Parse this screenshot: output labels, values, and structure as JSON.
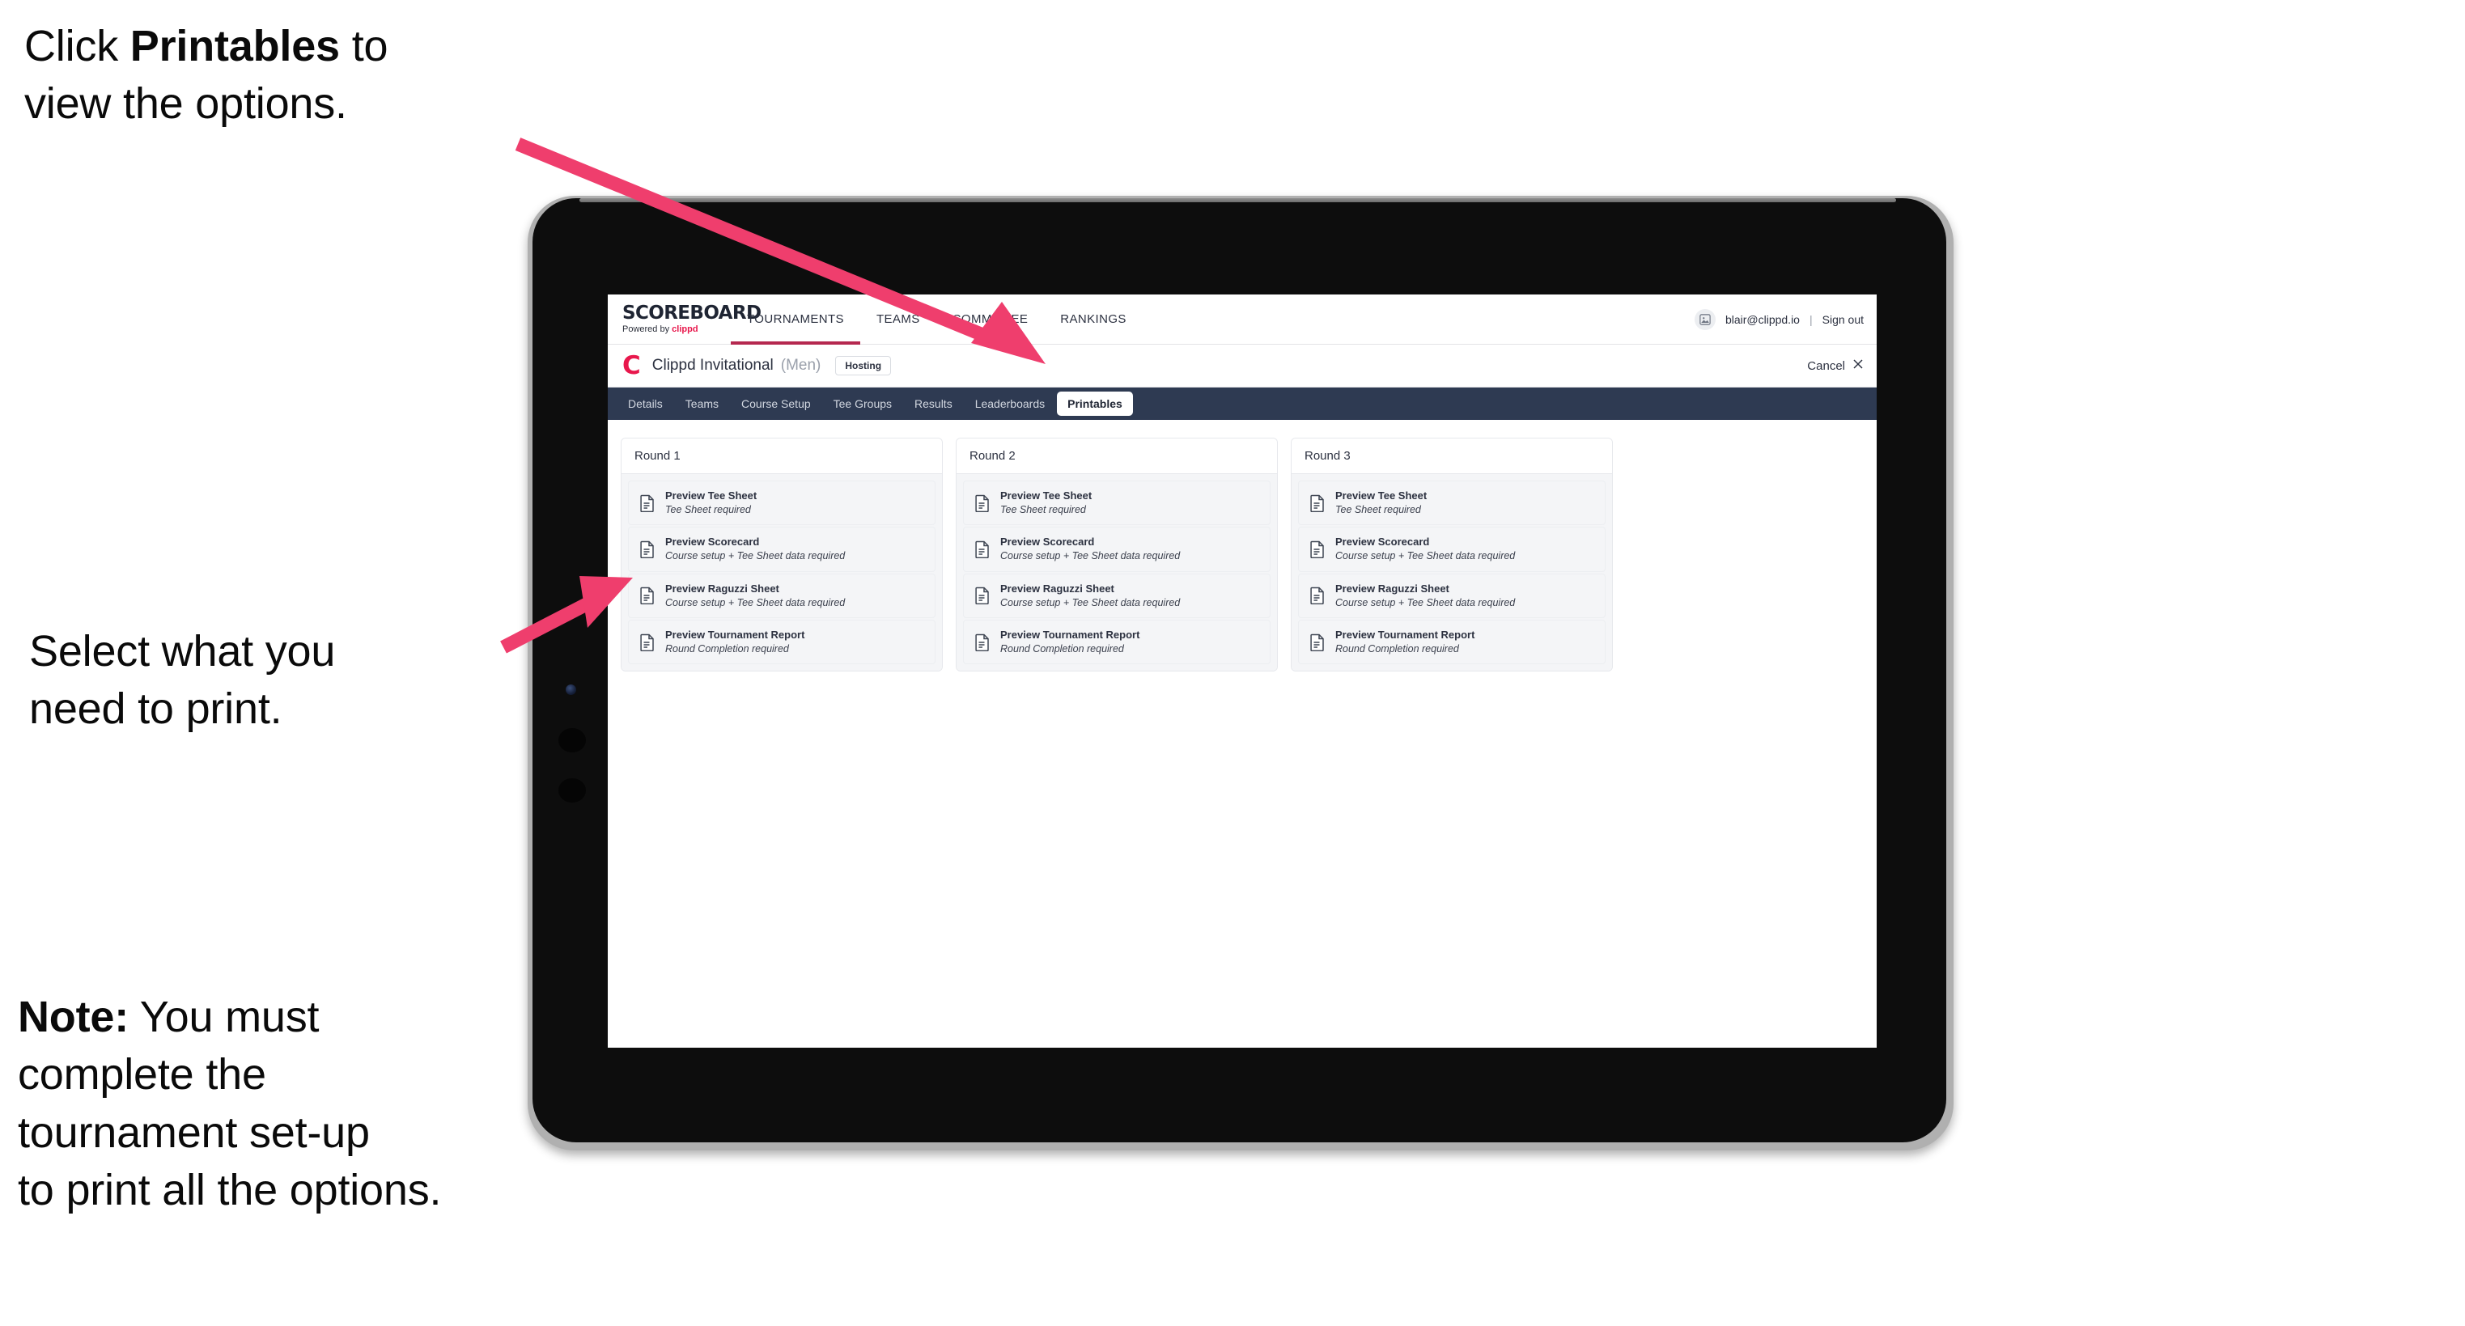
{
  "annotations": [
    {
      "id": "annot-1",
      "text_before": "Click ",
      "text_bold": "Printables",
      "text_after": " to\nview the options."
    },
    {
      "id": "annot-2",
      "text_before": "Select what you\n need to print.",
      "text_bold": "",
      "text_after": ""
    },
    {
      "id": "annot-3",
      "text_before": "",
      "text_bold": "Note:",
      "text_after": " You must\ncomplete the\ntournament set-up\nto print all the options."
    }
  ],
  "colors": {
    "arrow_pink": "#ef3e6d",
    "brand_pink": "#e8174c",
    "tabbar_navy": "#2e3a52",
    "active_underline": "#b5284f"
  },
  "app": {
    "brand": {
      "title": "SCOREBOARD",
      "subtitle_prefix": "Powered by ",
      "subtitle_brand": "clippd"
    },
    "main_nav": [
      {
        "label": "TOURNAMENTS",
        "active": true
      },
      {
        "label": "TEAMS",
        "active": false
      },
      {
        "label": "COMMITTEE",
        "active": false
      },
      {
        "label": "RANKINGS",
        "active": false
      }
    ],
    "account": {
      "avatar_icon": "user-avatar-icon",
      "email": "blair@clippd.io",
      "separator": "|",
      "sign_out_label": "Sign out"
    },
    "tournament_bar": {
      "logo_letter": "C",
      "name": "Clippd Invitational",
      "gender": "(Men)",
      "status_chip": "Hosting",
      "cancel_label": "Cancel",
      "cancel_icon": "close-icon"
    },
    "tabs": [
      {
        "label": "Details",
        "active": false
      },
      {
        "label": "Teams",
        "active": false
      },
      {
        "label": "Course Setup",
        "active": false
      },
      {
        "label": "Tee Groups",
        "active": false
      },
      {
        "label": "Results",
        "active": false
      },
      {
        "label": "Leaderboards",
        "active": false
      },
      {
        "label": "Printables",
        "active": true
      }
    ],
    "rounds": [
      {
        "title": "Round 1",
        "items": [
          {
            "icon": "document-icon",
            "title": "Preview Tee Sheet",
            "subtitle": "Tee Sheet required"
          },
          {
            "icon": "document-icon",
            "title": "Preview Scorecard",
            "subtitle": "Course setup + Tee Sheet data required"
          },
          {
            "icon": "document-icon",
            "title": "Preview Raguzzi Sheet",
            "subtitle": "Course setup + Tee Sheet data required"
          },
          {
            "icon": "document-icon",
            "title": "Preview Tournament Report",
            "subtitle": "Round Completion required"
          }
        ]
      },
      {
        "title": "Round 2",
        "items": [
          {
            "icon": "document-icon",
            "title": "Preview Tee Sheet",
            "subtitle": "Tee Sheet required"
          },
          {
            "icon": "document-icon",
            "title": "Preview Scorecard",
            "subtitle": "Course setup + Tee Sheet data required"
          },
          {
            "icon": "document-icon",
            "title": "Preview Raguzzi Sheet",
            "subtitle": "Course setup + Tee Sheet data required"
          },
          {
            "icon": "document-icon",
            "title": "Preview Tournament Report",
            "subtitle": "Round Completion required"
          }
        ]
      },
      {
        "title": "Round 3",
        "items": [
          {
            "icon": "document-icon",
            "title": "Preview Tee Sheet",
            "subtitle": "Tee Sheet required"
          },
          {
            "icon": "document-icon",
            "title": "Preview Scorecard",
            "subtitle": "Course setup + Tee Sheet data required"
          },
          {
            "icon": "document-icon",
            "title": "Preview Raguzzi Sheet",
            "subtitle": "Course setup + Tee Sheet data required"
          },
          {
            "icon": "document-icon",
            "title": "Preview Tournament Report",
            "subtitle": "Round Completion required"
          }
        ]
      }
    ]
  }
}
